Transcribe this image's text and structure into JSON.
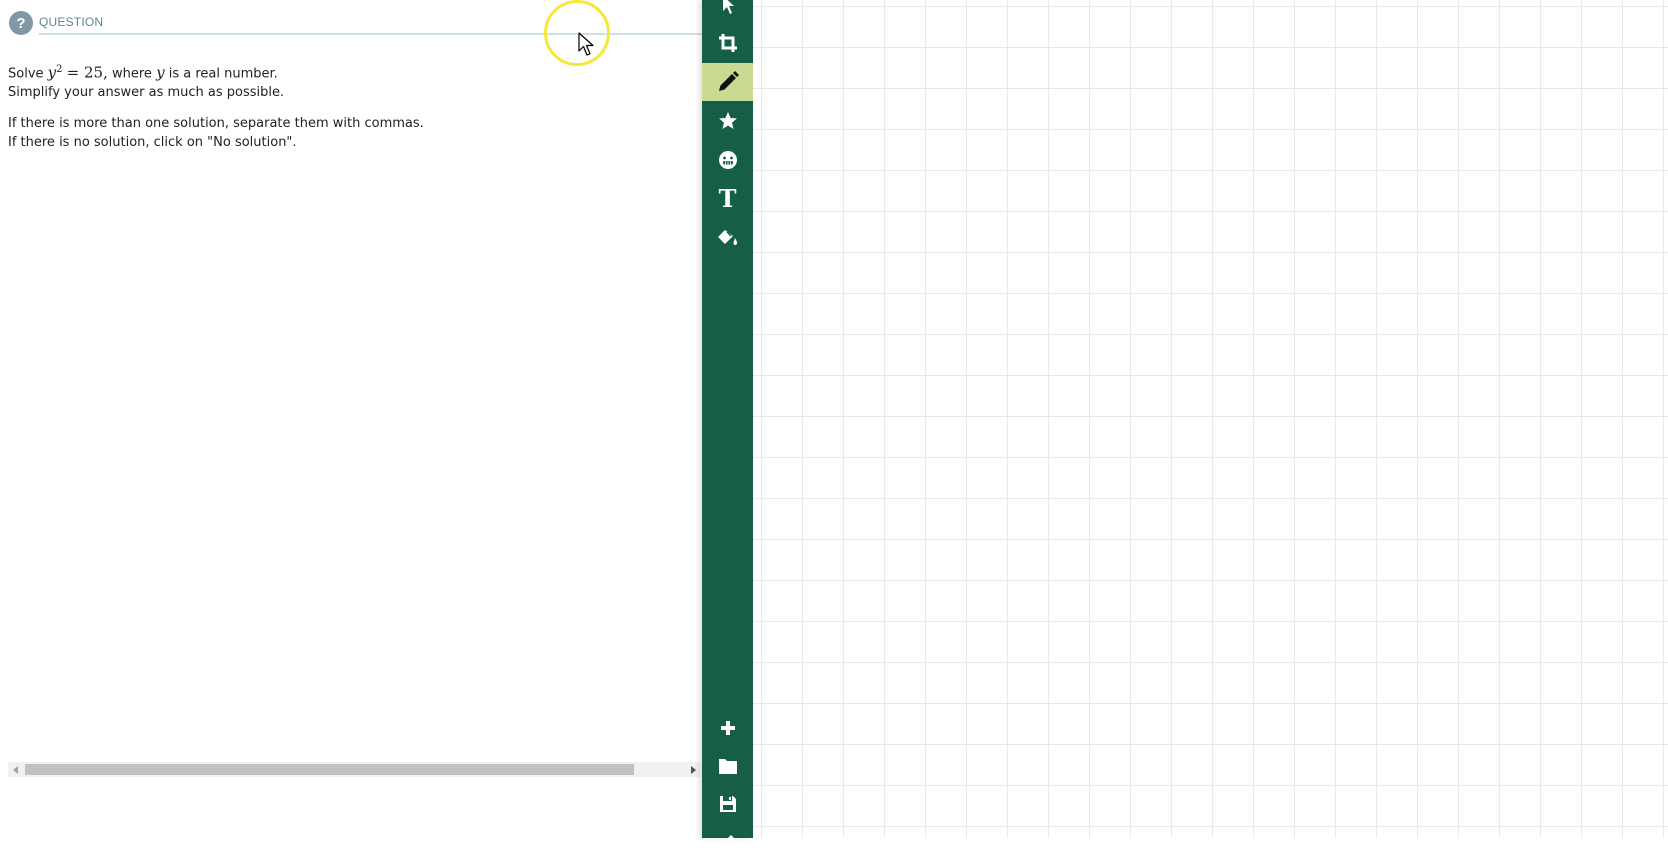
{
  "question": {
    "icon_glyph": "?",
    "header_label": "QUESTION",
    "line1_prefix": "Solve",
    "line1_var": "y",
    "line1_exponent": "2",
    "line1_equals": "= 25,",
    "line1_mid": "where",
    "line1_var2": "y",
    "line1_suffix": "is a real number.",
    "line2": "Simplify your answer as much as possible.",
    "line3": "If there is more than one solution, separate them with commas.",
    "line4": "If there is no solution, click on \"No solution\"."
  },
  "toolbar": {
    "background": "#175e48",
    "active_color": "#c9db92",
    "tools_top": [
      "select-pointer-icon",
      "crop-icon",
      "pencil-icon",
      "star-icon",
      "emoji-icon",
      "text-icon",
      "paint-bucket-icon"
    ],
    "tools_bottom": [
      "plus-icon",
      "folder-icon",
      "save-icon"
    ],
    "text_tool_glyph": "T",
    "active_tool": "pencil-icon"
  },
  "colors": {
    "header_rule": "#cfe0e0",
    "header_text": "#5c8691",
    "cursor_highlight": "#f2ea3b"
  }
}
